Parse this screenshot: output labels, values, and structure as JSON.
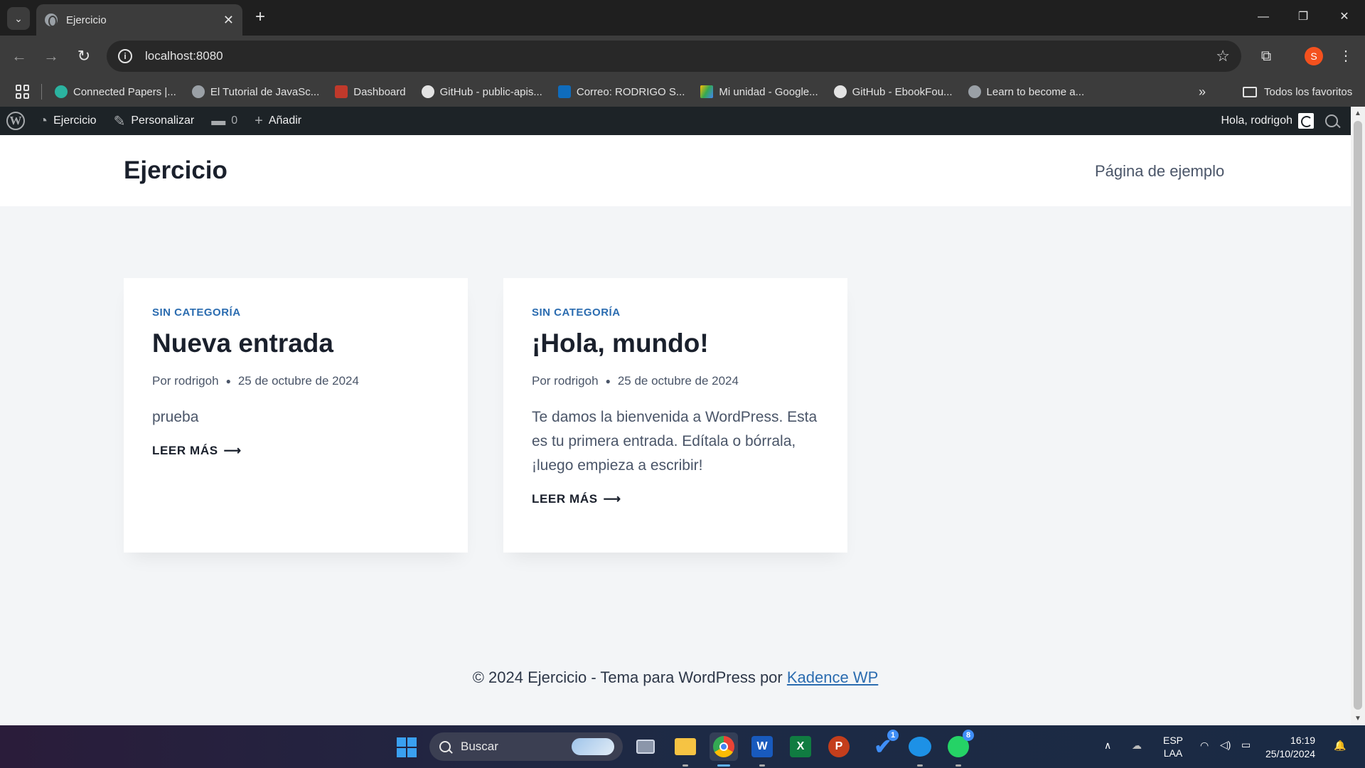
{
  "browser": {
    "tab_title": "Ejercicio",
    "url": "localhost:8080",
    "profile_initial": "S",
    "bookmarks": [
      {
        "label": "Connected Papers |...",
        "color": "#2bb3a0"
      },
      {
        "label": "El Tutorial de JavaSc...",
        "color": "#9aa0a6"
      },
      {
        "label": "Dashboard",
        "color": "#c0392b"
      },
      {
        "label": "GitHub - public-apis...",
        "color": "#e3e3e3"
      },
      {
        "label": "Correo: RODRIGO S...",
        "color": "#0f6cbd"
      },
      {
        "label": "Mi unidad - Google...",
        "color": "#34a853"
      },
      {
        "label": "GitHub - EbookFou...",
        "color": "#e3e3e3"
      },
      {
        "label": "Learn to become a...",
        "color": "#9aa0a6"
      }
    ],
    "all_bookmarks_label": "Todos los favoritos"
  },
  "adminbar": {
    "site_label": "Ejercicio",
    "customize_label": "Personalizar",
    "comments_count": "0",
    "add_label": "Añadir",
    "greeting": "Hola, rodrigoh"
  },
  "site": {
    "title": "Ejercicio",
    "nav_link": "Página de ejemplo"
  },
  "posts": [
    {
      "category": "SIN CATEGORÍA",
      "title": "Nueva entrada",
      "author": "Por rodrigoh",
      "date": "25 de octubre de 2024",
      "excerpt": "prueba",
      "read_more": "LEER MÁS"
    },
    {
      "category": "SIN CATEGORÍA",
      "title": "¡Hola, mundo!",
      "author": "Por rodrigoh",
      "date": "25 de octubre de 2024",
      "excerpt": "Te damos la bienvenida a WordPress. Esta es tu primera entrada. Edítala o bórrala, ¡luego empieza a escribir!",
      "read_more": "LEER MÁS"
    }
  ],
  "footer": {
    "text": "© 2024 Ejercicio - Tema para WordPress por",
    "link": "Kadence WP"
  },
  "taskbar": {
    "search_placeholder": "Buscar",
    "badge_todo": "1",
    "badge_whatsapp": "8",
    "lang_line1": "ESP",
    "lang_line2": "LAA",
    "time": "16:19",
    "date": "25/10/2024"
  },
  "colors": {
    "accent": "#2b6cb0",
    "adminbar_bg": "#1d2327",
    "page_bg": "#f3f5f7"
  }
}
